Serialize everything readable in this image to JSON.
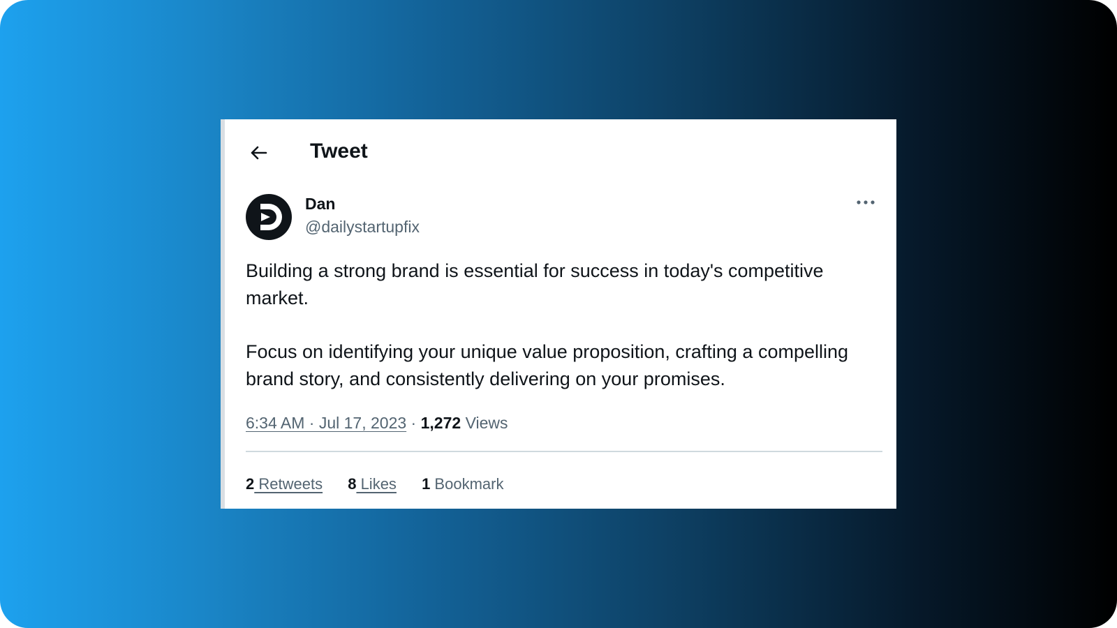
{
  "header": {
    "title": "Tweet",
    "back_icon": "arrow-left-icon"
  },
  "author": {
    "name": "Dan",
    "handle": "@dailystartupfix",
    "avatar_icon": "play-logo-avatar"
  },
  "more_icon": "more-horizontal-icon",
  "tweet": {
    "paragraphs": [
      "Building a strong brand is essential for success in today's competitive market.",
      "Focus on identifying your unique value proposition, crafting a compelling brand story, and consistently delivering on your promises."
    ],
    "timestamp": "6:34 AM · Jul 17, 2023",
    "separator": "·",
    "views_count": "1,272",
    "views_label": "Views"
  },
  "stats": {
    "retweets_count": "2",
    "retweets_label": " Retweets",
    "likes_count": "8",
    "likes_label": " Likes",
    "bookmarks_count": "1",
    "bookmarks_label": " Bookmark"
  },
  "colors": {
    "gradient_start": "#1da1ee",
    "gradient_end": "#000000",
    "text_primary": "#0f1419",
    "text_secondary": "#536471"
  }
}
